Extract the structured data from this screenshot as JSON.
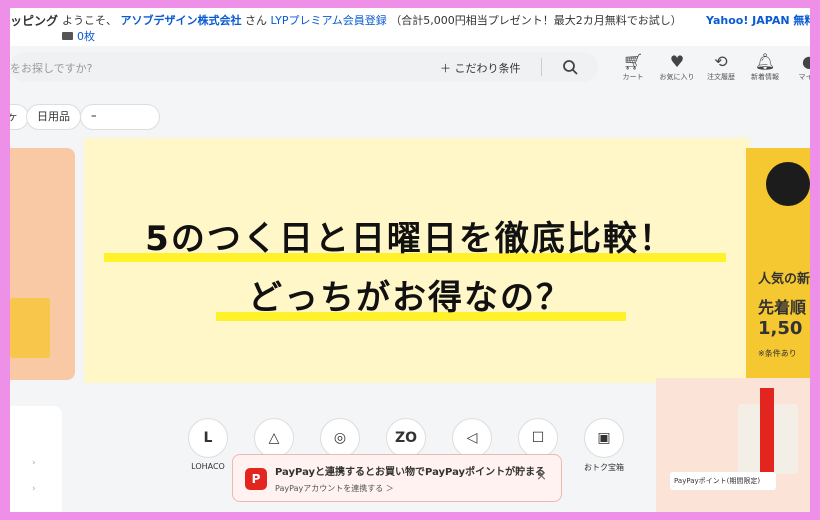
{
  "header": {
    "brand_fragment": "ッピング",
    "welcome_prefix": "ようこそ、",
    "company": "アソブデザイン株式会社",
    "honorific": "さん",
    "premium_link": "LYPプレミアム会員登録",
    "premium_note": "（合計5,000円相当プレゼント！最大2カ月無料でお試し）",
    "yahoo_link": "Yahoo! JAPAN",
    "yahoo_link2": "無料",
    "coupon_count": "0枚"
  },
  "search": {
    "placeholder": "をお探しですか?",
    "advanced_label": "＋ こだわり条件"
  },
  "header_icons": [
    {
      "label": "カート",
      "icon": "cart-icon"
    },
    {
      "label": "お気に入り",
      "icon": "heart-icon"
    },
    {
      "label": "注文履歴",
      "icon": "history-icon"
    },
    {
      "label": "新着情報",
      "icon": "bell-icon"
    },
    {
      "label": "マイペ",
      "icon": "user-icon"
    }
  ],
  "tags": [
    "ヶ",
    "日用品",
    "ｰ"
  ],
  "headline": {
    "line1": "5のつく日と日曜日を徹底比較！",
    "line2": "どっちがお得なの？"
  },
  "right_banner": {
    "line1": "人気の新",
    "line2": "先着順",
    "line3": "1,50",
    "note": "※条件あり"
  },
  "services": [
    {
      "label": "LOHACO",
      "badge": "L"
    },
    {
      "label": "",
      "badge": "△"
    },
    {
      "label": "",
      "badge": "◎"
    },
    {
      "label": "",
      "badge": "ZO"
    },
    {
      "label": "",
      "badge": "◁"
    },
    {
      "label": "",
      "badge": "☐"
    },
    {
      "label": "おトク宝箱",
      "badge": "▣"
    }
  ],
  "paypay_toast": {
    "title": "PayPayと連携するとお買い物でPayPayポイントが貯まる",
    "link": "PayPayアカウントを連携する ＞",
    "close": "×"
  },
  "gift_label": "PayPayポイント(期間限定)",
  "colors": {
    "link": "#0a5bd1",
    "highlight": "#fff22a",
    "frame": "#ee8fe8",
    "paypay": "#e3251f"
  }
}
